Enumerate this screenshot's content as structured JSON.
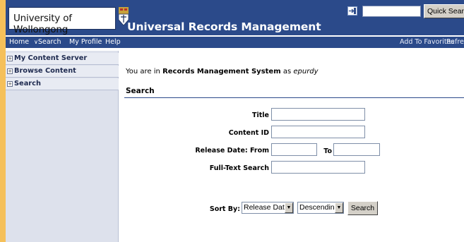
{
  "header": {
    "logo_text": "University of Wollongong",
    "app_title": "Universal Records Management",
    "quick_search": {
      "placeholder": "",
      "value": "",
      "button_label": "Quick Search"
    }
  },
  "nav": {
    "items": [
      "Home",
      "Search",
      "My Profile",
      "Help"
    ],
    "right_items": [
      "Add To Favorites",
      "Refre"
    ]
  },
  "sidebar": {
    "items": [
      {
        "expander": "+",
        "label": "My Content Server"
      },
      {
        "expander": "+",
        "label": "Browse Content"
      },
      {
        "expander": "+",
        "label": "Search"
      }
    ]
  },
  "main": {
    "location_prefix": "You are in",
    "location_name": "Records Management System",
    "location_as": "as",
    "location_user": "epurdy",
    "section_title": "Search",
    "fields": {
      "title_label": "Title",
      "content_id_label": "Content ID",
      "release_date_label": "Release Date: From",
      "to_label": "To",
      "fulltext_label": "Full-Text Search"
    },
    "sort": {
      "label": "Sort By:",
      "field_value": "Release Date",
      "order_value": "Descending",
      "search_button": "Search"
    }
  },
  "colors": {
    "header_bg": "#2b4a8a",
    "page_bg": "#f5c05a",
    "sidebar_bg": "#dde1ec"
  }
}
